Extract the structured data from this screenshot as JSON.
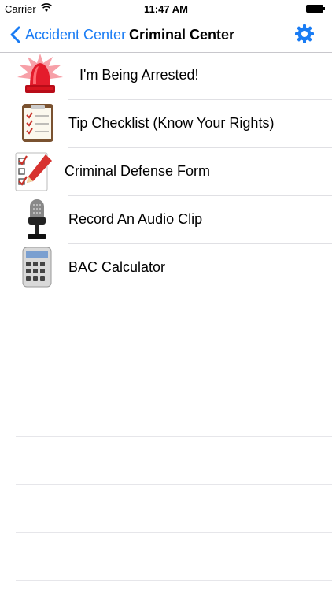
{
  "status_bar": {
    "carrier": "Carrier",
    "time": "11:47 AM"
  },
  "nav": {
    "back_label": "Accident Center",
    "title": "Criminal Center",
    "accent_color": "#1a7cf4"
  },
  "menu_items": [
    {
      "label": "I'm Being Arrested!",
      "icon": "siren-icon"
    },
    {
      "label": "Tip Checklist (Know Your Rights)",
      "icon": "notepad-checklist-icon"
    },
    {
      "label": "Criminal Defense Form",
      "icon": "checklist-pencil-icon"
    },
    {
      "label": "Record An Audio Clip",
      "icon": "microphone-icon"
    },
    {
      "label": "BAC Calculator",
      "icon": "calculator-icon"
    }
  ]
}
